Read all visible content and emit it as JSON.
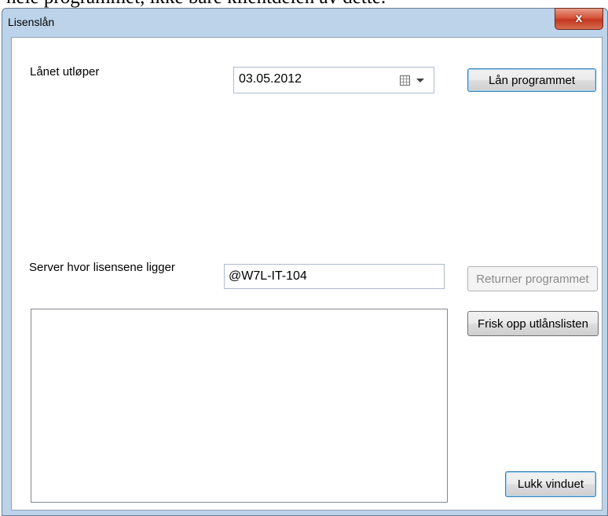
{
  "background": {
    "text": "hele programmet, ikke bare klientdelen av dette."
  },
  "window": {
    "title": "Lisenslån",
    "close_label": "x"
  },
  "loan": {
    "expires_label": "Lånet utløper",
    "expires_value": "03.05.2012",
    "borrow_button": "Lån programmet"
  },
  "server": {
    "label": "Server hvor lisensene ligger",
    "value": "@W7L-IT-104",
    "return_button": "Returner programmet"
  },
  "loans_list": {
    "items": [],
    "refresh_button": "Frisk opp utlånslisten"
  },
  "footer": {
    "close_button": "Lukk vinduet"
  },
  "colors": {
    "close_button_red": "#c3361f",
    "frame_blue": "#bcd3ea"
  }
}
